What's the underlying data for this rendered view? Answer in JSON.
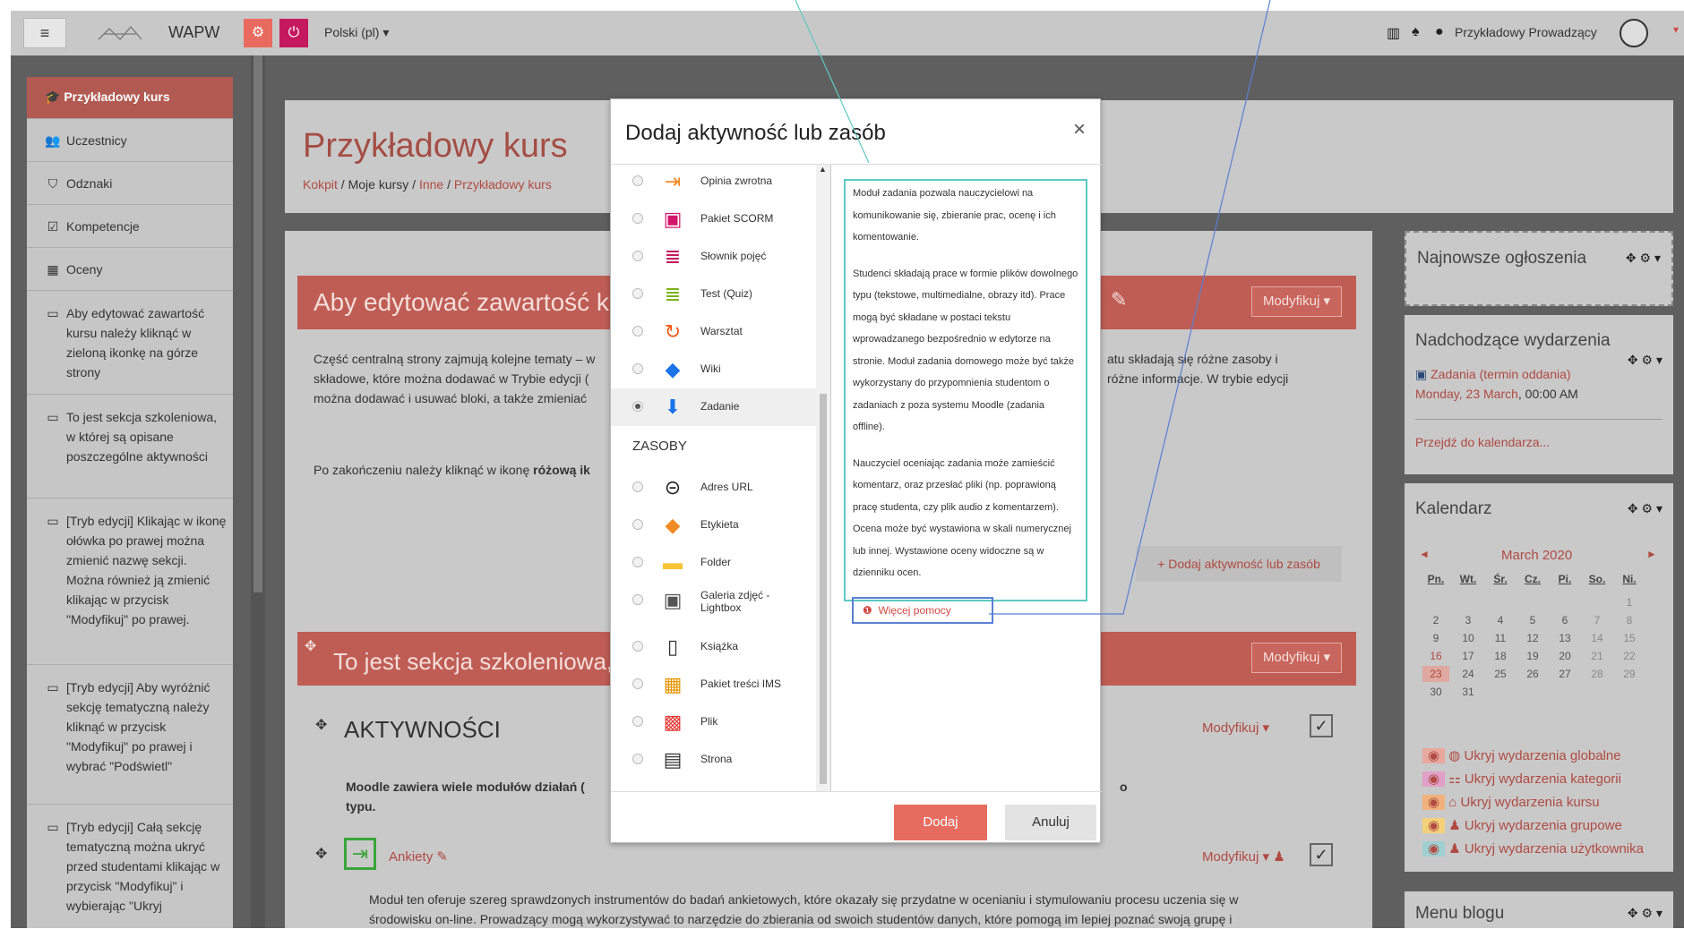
{
  "topbar": {
    "brand": "WAPW",
    "language": "Polski (pl)",
    "user_name": "Przykładowy Prowadzący"
  },
  "sidebar": {
    "active": "Przykładowy kurs",
    "items": [
      {
        "label": "Uczestnicy",
        "icon": "users-icon"
      },
      {
        "label": "Odznaki",
        "icon": "shield-icon"
      },
      {
        "label": "Kompetencje",
        "icon": "check-square-icon"
      },
      {
        "label": "Oceny",
        "icon": "table-icon"
      },
      {
        "label": "Aby edytować zawartość kursu należy kliknąć w zieloną ikonkę na górze strony",
        "icon": "folder-icon"
      },
      {
        "label": "To jest sekcja szkoleniowa, w której są opisane poszczególne aktywności",
        "icon": "folder-icon"
      },
      {
        "label": "[Tryb edycji] Klikając w ikonę ołówka po prawej można zmienić nazwę sekcji. Można również ją zmienić klikając w przycisk \"Modyfikuj\" po prawej.",
        "icon": "folder-icon"
      },
      {
        "label": "[Tryb edycji] Aby wyróżnić sekcję tematyczną należy kliknąć w przycisk \"Modyfikuj\" po prawej i wybrać \"Podświetl\"",
        "icon": "folder-icon"
      },
      {
        "label": "[Tryb edycji] Całą sekcję tematyczną można ukryć przed studentami klikając w przycisk \"Modyfikuj\" i wybierając \"Ukryj",
        "icon": "folder-icon"
      }
    ]
  },
  "course": {
    "title": "Przykładowy kurs",
    "breadcrumb": [
      "Kokpit",
      "Moje kursy",
      "Inne",
      "Przykładowy kurs"
    ]
  },
  "main": {
    "section1_title": "Aby edytować zawartość kurs",
    "modify": "Modyfikuj",
    "section1_text_left": "Część centralną strony zajmują kolejne tematy – w\nskładowe, które można dodawać w Trybie edycji (\nmożna dodawać i usuwać bloki, a także zmieniać",
    "section1_text_right": "atu składają się różne zasoby i\nróżne informacje. W trybie edycji",
    "section1_end_prefix": "Po zakończeniu należy kliknąć w ikonę ",
    "section1_end_bold": "różową ik",
    "add_activity": "Dodaj aktywność lub zasób",
    "section2_title": "To jest sekcja szkoleniowa, w",
    "activities_heading": "AKTYWNOŚCI",
    "modules_text_left": "Moodle zawiera wiele modułów działań (",
    "modules_text_left2": "typu.",
    "modules_text_right": "o",
    "ankiety": "Ankiety",
    "ankiety_desc": "Moduł ten oferuje szereg sprawdzonych instrumentów do badań ankietowych, które okazały się przydatne w ocenianiu i stymulowaniu procesu uczenia się w",
    "ankiety_desc2": "środowisku on-line. Prowadzący mogą wykorzystywać to narzędzie do zbierania od swoich studentów danych, które pomogą im lepiej poznać swoją grupę i"
  },
  "blocks": {
    "announcements": "Najnowsze ogłoszenia",
    "upcoming": "Nadchodzące wydarzenia",
    "upcoming_event": "Zadania (termin oddania)",
    "upcoming_date": "Monday, 23 March",
    "upcoming_time": ", 00:00 AM",
    "goto_calendar": "Przejdź do kalendarza...",
    "calendar": "Kalendarz",
    "month": "March 2020",
    "weekdays": [
      "Pn.",
      "Wt.",
      "Śr.",
      "Cz.",
      "Pi.",
      "So.",
      "Ni."
    ],
    "weeks": [
      [
        "",
        "",
        "",
        "",
        "",
        "",
        "1"
      ],
      [
        "2",
        "3",
        "4",
        "5",
        "6",
        "7",
        "8"
      ],
      [
        "9",
        "10",
        "11",
        "12",
        "13",
        "14",
        "15"
      ],
      [
        "16",
        "17",
        "18",
        "19",
        "20",
        "21",
        "22"
      ],
      [
        "23",
        "24",
        "25",
        "26",
        "27",
        "28",
        "29"
      ],
      [
        "30",
        "31",
        "",
        "",
        "",
        "",
        ""
      ]
    ],
    "hide_global": "Ukryj wydarzenia globalne",
    "hide_category": "Ukryj wydarzenia kategorii",
    "hide_course": "Ukryj wydarzenia kursu",
    "hide_group": "Ukryj wydarzenia grupowe",
    "hide_user": "Ukryj wydarzenia użytkownika",
    "blog_menu": "Menu blogu"
  },
  "modal": {
    "title": "Dodaj aktywność lub zasób",
    "close": "×",
    "activities": [
      {
        "label": "Opinia zwrotna",
        "icon": "feedback-icon"
      },
      {
        "label": "Pakiet SCORM",
        "icon": "scorm-icon"
      },
      {
        "label": "Słownik pojęć",
        "icon": "glossary-icon"
      },
      {
        "label": "Test (Quiz)",
        "icon": "quiz-icon"
      },
      {
        "label": "Warsztat",
        "icon": "workshop-icon"
      },
      {
        "label": "Wiki",
        "icon": "wiki-icon"
      },
      {
        "label": "Zadanie",
        "icon": "assignment-icon",
        "selected": true
      }
    ],
    "resources_heading": "ZASOBY",
    "resources": [
      {
        "label": "Adres URL",
        "icon": "url-icon"
      },
      {
        "label": "Etykieta",
        "icon": "label-icon"
      },
      {
        "label": "Folder",
        "icon": "folder-icon"
      },
      {
        "label": "Galeria zdjęć -\nLightbox",
        "icon": "gallery-icon"
      },
      {
        "label": "Książka",
        "icon": "book-icon"
      },
      {
        "label": "Pakiet treści IMS",
        "icon": "ims-icon"
      },
      {
        "label": "Plik",
        "icon": "file-icon"
      },
      {
        "label": "Strona",
        "icon": "page-icon"
      }
    ],
    "help_p1": "Moduł zadania pozwala nauczycielowi na komunikowanie się, zbieranie prac, ocenę i ich komentowanie.",
    "help_p2": "Studenci składają prace w formie plików dowolnego typu (tekstowe, multimedialne, obrazy itd). Prace mogą być składane w postaci tekstu wprowadzanego bezpośrednio w edytorze na stronie. Moduł zadania domowego może być także wykorzystany do przypomnienia studentom o zadaniach z poza systemu Moodle (zadania offline).",
    "help_p3": "Nauczyciel oceniając zadania może zamieścić komentarz, oraz przesłać pliki (np. poprawioną pracę studenta, czy plik audio z komentarzem). Ocena może być wystawiona w skali numerycznej lub innej. Wystawione oceny widoczne są w dzienniku ocen.",
    "more_help": "Więcej pomocy",
    "add_button": "Dodaj",
    "cancel_button": "Anuluj"
  }
}
